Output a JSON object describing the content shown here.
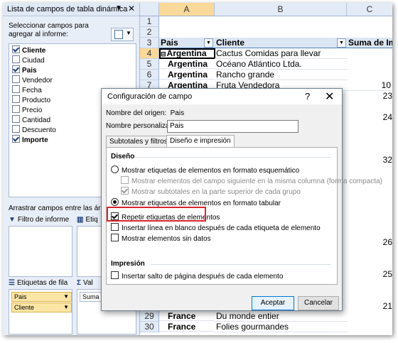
{
  "field_list": {
    "title": "Lista de campos de tabla dinámica",
    "instructions": "Seleccionar campos para agregar al informe:",
    "fields": [
      {
        "label": "Cliente",
        "checked": true
      },
      {
        "label": "Ciudad",
        "checked": false
      },
      {
        "label": "Pais",
        "checked": true
      },
      {
        "label": "Vendedor",
        "checked": false
      },
      {
        "label": "Fecha",
        "checked": false
      },
      {
        "label": "Producto",
        "checked": false
      },
      {
        "label": "Precio",
        "checked": false
      },
      {
        "label": "Cantidad",
        "checked": false
      },
      {
        "label": "Descuento",
        "checked": false
      },
      {
        "label": "Importe",
        "checked": true
      }
    ],
    "drag_label": "Arrastrar campos entre las áreas",
    "report_filter": "Filtro de informe",
    "column_labels": "Etiq",
    "row_labels": "Etiquetas de fila",
    "values": "Val",
    "row_fields": [
      "Pais",
      "Cliente"
    ],
    "value_fields": [
      "Suma c"
    ]
  },
  "sheet": {
    "columns": [
      "A",
      "B",
      "C"
    ],
    "header": {
      "pais": "Pais",
      "cliente": "Cliente",
      "suma": "Suma de Im"
    },
    "rows": [
      {
        "n": "1",
        "a": "",
        "b": "",
        "c": ""
      },
      {
        "n": "2",
        "a": "",
        "b": "",
        "c": ""
      },
      {
        "n": "3",
        "a": "",
        "b": "",
        "c": ""
      },
      {
        "n": "4",
        "a": "Argentina",
        "b": "Cactus Comidas para llevar",
        "c": ""
      },
      {
        "n": "5",
        "a": "Argentina",
        "b": "Océano Atlántico Ltda.",
        "c": ""
      },
      {
        "n": "6",
        "a": "Argentina",
        "b": "Rancho grande",
        "c": ""
      },
      {
        "n": "7",
        "a": "Argentina",
        "b": "Fruta Vendedora",
        "c": "10"
      }
    ],
    "bottom_rows": [
      {
        "n": "29",
        "a": "France",
        "b": "Du monde entier",
        "c": ""
      },
      {
        "n": "30",
        "a": "France",
        "b": "Folies gourmandes",
        "c": ""
      }
    ],
    "peek_values": [
      "23",
      "24",
      "32",
      "26",
      "25",
      "21"
    ]
  },
  "dialog": {
    "title": "Configuración de campo",
    "help": "?",
    "close": "✕",
    "origin_label": "Nombre del origen:",
    "origin_value": "Pais",
    "custom_label": "Nombre personalizado:",
    "custom_value": "Pais",
    "tabs": [
      "Subtotales y filtros",
      "Diseño e impresión"
    ],
    "section_layout": "Diseño",
    "opt_outline": "Mostrar etiquetas de elementos en formato esquemático",
    "opt_compact": "Mostrar elementos del campo siguiente en la misma columna (forma compacta)",
    "opt_subtotals_top": "Mostrar subtotales en la parte superior de cada grupo",
    "opt_tabular": "Mostrar etiquetas de elementos en formato tabular",
    "opt_repeat": "Repetir etiquetas de elementos",
    "opt_blank_line": "Insertar línea en blanco después de cada etiqueta de elemento",
    "opt_no_data": "Mostrar elementos sin datos",
    "section_print": "Impresión",
    "opt_page_break": "Insertar salto de página después de cada elemento",
    "ok": "Aceptar",
    "cancel": "Cancelar"
  }
}
